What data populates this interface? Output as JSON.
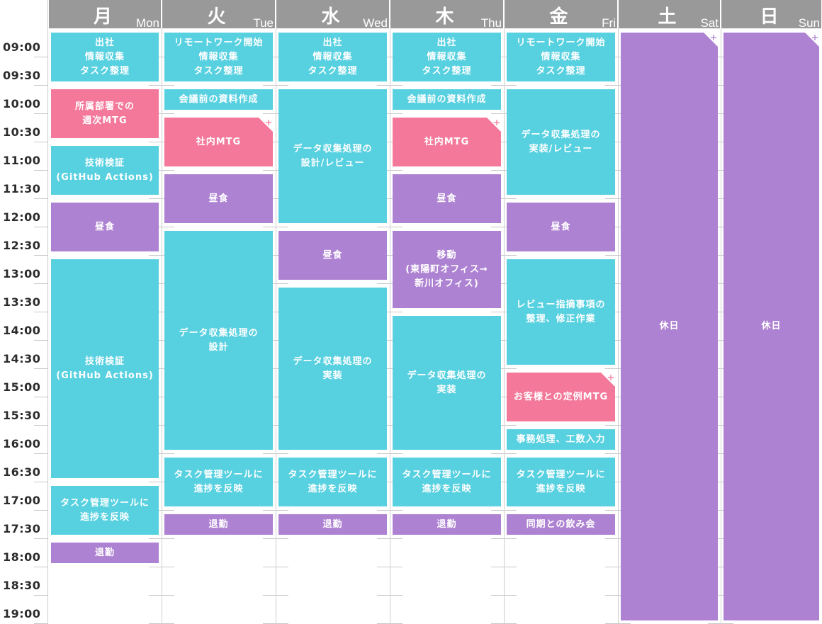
{
  "days": [
    {
      "jp": "月",
      "en": "Mon"
    },
    {
      "jp": "火",
      "en": "Tue"
    },
    {
      "jp": "水",
      "en": "Wed"
    },
    {
      "jp": "木",
      "en": "Thu"
    },
    {
      "jp": "金",
      "en": "Fri"
    },
    {
      "jp": "土",
      "en": "Sat"
    },
    {
      "jp": "日",
      "en": "Sun"
    }
  ],
  "times": [
    "09:00",
    "09:30",
    "10:00",
    "10:30",
    "11:00",
    "11:30",
    "12:00",
    "12:30",
    "13:00",
    "13:30",
    "14:00",
    "14:30",
    "15:00",
    "15:30",
    "16:00",
    "16:30",
    "17:00",
    "17:30",
    "18:00",
    "18:30",
    "19:00"
  ],
  "colors": {
    "cyan": "#57d0e0",
    "purple": "#ae82d2",
    "pink": "#f4789a",
    "header": "#999999"
  },
  "events": [
    {
      "day": 0,
      "start": "09:00",
      "end": "09:55",
      "label": "出社\n情報収集\nタスク整理",
      "color": "cyan"
    },
    {
      "day": 0,
      "start": "10:00",
      "end": "10:55",
      "label": "所属部署での\n週次MTG",
      "color": "pink"
    },
    {
      "day": 0,
      "start": "11:00",
      "end": "11:55",
      "label": "技術検証\n(GitHub Actions)",
      "color": "cyan"
    },
    {
      "day": 0,
      "start": "12:00",
      "end": "12:55",
      "label": "昼食",
      "color": "purple"
    },
    {
      "day": 0,
      "start": "13:00",
      "end": "16:55",
      "label": "技術検証\n(GitHub Actions)",
      "color": "cyan"
    },
    {
      "day": 0,
      "start": "17:00",
      "end": "17:55",
      "label": "タスク管理ツールに\n進捗を反映",
      "color": "cyan"
    },
    {
      "day": 0,
      "start": "18:00",
      "end": "18:25",
      "label": "退勤",
      "color": "purple"
    },
    {
      "day": 1,
      "start": "09:00",
      "end": "09:55",
      "label": "リモートワーク開始\n情報収集\nタスク整理",
      "color": "cyan"
    },
    {
      "day": 1,
      "start": "10:00",
      "end": "10:25",
      "label": "会議前の資料作成",
      "color": "cyan"
    },
    {
      "day": 1,
      "start": "10:30",
      "end": "11:25",
      "label": "社内MTG",
      "color": "pink",
      "plus": true
    },
    {
      "day": 1,
      "start": "11:30",
      "end": "12:25",
      "label": "昼食",
      "color": "purple"
    },
    {
      "day": 1,
      "start": "12:30",
      "end": "16:25",
      "label": "データ収集処理の\n設計",
      "color": "cyan"
    },
    {
      "day": 1,
      "start": "16:30",
      "end": "17:25",
      "label": "タスク管理ツールに\n進捗を反映",
      "color": "cyan"
    },
    {
      "day": 1,
      "start": "17:30",
      "end": "17:55",
      "label": "退勤",
      "color": "purple"
    },
    {
      "day": 2,
      "start": "09:00",
      "end": "09:55",
      "label": "出社\n情報収集\nタスク整理",
      "color": "cyan"
    },
    {
      "day": 2,
      "start": "10:00",
      "end": "12:25",
      "label": "データ収集処理の\n設計/レビュー",
      "color": "cyan"
    },
    {
      "day": 2,
      "start": "12:30",
      "end": "13:25",
      "label": "昼食",
      "color": "purple"
    },
    {
      "day": 2,
      "start": "13:30",
      "end": "16:25",
      "label": "データ収集処理の\n実装",
      "color": "cyan"
    },
    {
      "day": 2,
      "start": "16:30",
      "end": "17:25",
      "label": "タスク管理ツールに\n進捗を反映",
      "color": "cyan"
    },
    {
      "day": 2,
      "start": "17:30",
      "end": "17:55",
      "label": "退勤",
      "color": "purple"
    },
    {
      "day": 3,
      "start": "09:00",
      "end": "09:55",
      "label": "出社\n情報収集\nタスク整理",
      "color": "cyan"
    },
    {
      "day": 3,
      "start": "10:00",
      "end": "10:25",
      "label": "会議前の資料作成",
      "color": "cyan"
    },
    {
      "day": 3,
      "start": "10:30",
      "end": "11:25",
      "label": "社内MTG",
      "color": "pink",
      "plus": true
    },
    {
      "day": 3,
      "start": "11:30",
      "end": "12:25",
      "label": "昼食",
      "color": "purple"
    },
    {
      "day": 3,
      "start": "12:30",
      "end": "13:55",
      "label": "移動\n(東陽町オフィス→\n新川オフィス)",
      "color": "purple"
    },
    {
      "day": 3,
      "start": "14:00",
      "end": "16:25",
      "label": "データ収集処理の\n実装",
      "color": "cyan"
    },
    {
      "day": 3,
      "start": "16:30",
      "end": "17:25",
      "label": "タスク管理ツールに\n進捗を反映",
      "color": "cyan"
    },
    {
      "day": 3,
      "start": "17:30",
      "end": "17:55",
      "label": "退勤",
      "color": "purple"
    },
    {
      "day": 4,
      "start": "09:00",
      "end": "09:55",
      "label": "リモートワーク開始\n情報収集\nタスク整理",
      "color": "cyan"
    },
    {
      "day": 4,
      "start": "10:00",
      "end": "11:55",
      "label": "データ収集処理の\n実装/レビュー",
      "color": "cyan"
    },
    {
      "day": 4,
      "start": "12:00",
      "end": "12:55",
      "label": "昼食",
      "color": "purple"
    },
    {
      "day": 4,
      "start": "13:00",
      "end": "14:55",
      "label": "レビュー指摘事項の\n整理、修正作業",
      "color": "cyan"
    },
    {
      "day": 4,
      "start": "15:00",
      "end": "15:55",
      "label": "お客様との定例MTG",
      "color": "pink",
      "plus": true
    },
    {
      "day": 4,
      "start": "16:00",
      "end": "16:25",
      "label": "事務処理、工数入力",
      "color": "cyan"
    },
    {
      "day": 4,
      "start": "16:30",
      "end": "17:25",
      "label": "タスク管理ツールに\n進捗を反映",
      "color": "cyan"
    },
    {
      "day": 4,
      "start": "17:30",
      "end": "17:55",
      "label": "同期との飲み会",
      "color": "purple"
    },
    {
      "day": 5,
      "start": "09:00",
      "end": "19:00",
      "label": "休日",
      "color": "purple",
      "plus": true
    },
    {
      "day": 6,
      "start": "09:00",
      "end": "19:00",
      "label": "休日",
      "color": "purple",
      "plus": true
    }
  ]
}
